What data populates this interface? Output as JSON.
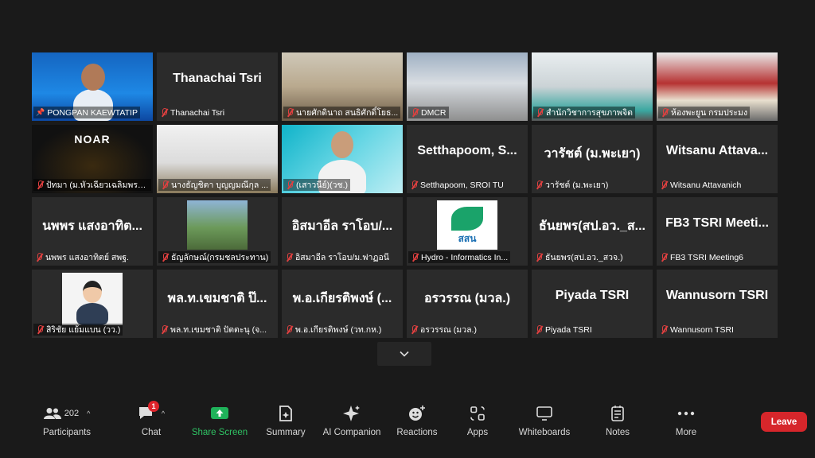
{
  "tiles": [
    {
      "name": "PONGPAN KAEWTATIP",
      "big": "",
      "kind": "video",
      "fill": "v-blue",
      "pinned": true,
      "muted": false,
      "active": true
    },
    {
      "name": "Thanachai Tsri",
      "big": "Thanachai Tsri",
      "kind": "name",
      "muted": true
    },
    {
      "name": "นายศักดินาถ สนธิศักดิ์โยธ...",
      "big": "",
      "kind": "video",
      "fill": "v-office",
      "muted": true
    },
    {
      "name": "DMCR",
      "big": "",
      "kind": "video",
      "fill": "v-room",
      "muted": true
    },
    {
      "name": "สำนักวิชาการสุขภาพจิต",
      "big": "",
      "kind": "video",
      "fill": "v-room2",
      "muted": true
    },
    {
      "name": "ห้องพะยูน กรมประมง",
      "big": "",
      "kind": "video",
      "fill": "v-hall",
      "muted": true
    },
    {
      "name": "ปัทมา (ม.หัวเฉียวเฉลิมพระ...",
      "big": "",
      "kind": "video",
      "fill": "v-dark",
      "muted": true,
      "logo": "NOAR"
    },
    {
      "name": "นางธัญชิตา บุญญมณีกุล ...",
      "big": "",
      "kind": "video",
      "fill": "v-desk",
      "muted": true
    },
    {
      "name": "(เสาวนีย์)(วช.)",
      "big": "",
      "kind": "video",
      "fill": "v-cyan",
      "muted": true
    },
    {
      "name": "Setthapoom, SROI TU",
      "big": "Setthapoom, S...",
      "kind": "name",
      "muted": true
    },
    {
      "name": "วารัชต์ (ม.พะเยา)",
      "big": "วารัชต์ (ม.พะเยา)",
      "kind": "name",
      "muted": true
    },
    {
      "name": "Witsanu Attavanich",
      "big": "Witsanu Attava...",
      "kind": "name",
      "muted": true
    },
    {
      "name": "นพพร แสงอาทิตย์ สพฐ.",
      "big": "นพพร แสงอาทิต...",
      "kind": "name",
      "muted": true
    },
    {
      "name": "ธัญลักษณ์(กรมชลประทาน)",
      "big": "",
      "kind": "image",
      "muted": true,
      "img": "photo"
    },
    {
      "name": "อิสมาอีล ราโอบ/ม.ฟาฏอนี",
      "big": "อิสมาอีล ราโอบ/...",
      "kind": "name",
      "muted": true
    },
    {
      "name": "Hydro - Informatics In...",
      "big": "",
      "kind": "image",
      "muted": true,
      "img": "logo",
      "logo_text": "สสน"
    },
    {
      "name": "ธันยพร(สป.อว._สวจ.)",
      "big": "ธันยพร(สป.อว._ส...",
      "kind": "name",
      "muted": true
    },
    {
      "name": "FB3 TSRI Meeting6",
      "big": "FB3 TSRI Meeti...",
      "kind": "name",
      "muted": true
    },
    {
      "name": "สิริชัย แย้มแบน (วว.)",
      "big": "",
      "kind": "image",
      "muted": true,
      "img": "avatar"
    },
    {
      "name": "พล.ท.เขมชาติ ปัตตะนุ (จ...",
      "big": "พล.ท.เขมชาติ ป๊...",
      "kind": "name",
      "muted": true
    },
    {
      "name": "พ.อ.เกียรติพงษ์ (วท.กห.)",
      "big": "พ.อ.เกียรติพงษ์ (...",
      "kind": "name",
      "muted": true
    },
    {
      "name": "อรวรรณ (มวล.)",
      "big": "อรวรรณ (มวล.)",
      "kind": "name",
      "muted": true
    },
    {
      "name": "Piyada TSRI",
      "big": "Piyada TSRI",
      "kind": "name",
      "muted": true
    },
    {
      "name": "Wannusorn TSRI",
      "big": "Wannusorn TSRI",
      "kind": "name",
      "muted": true
    }
  ],
  "toolbar": {
    "participants": {
      "label": "Participants",
      "count": "202"
    },
    "chat": {
      "label": "Chat",
      "badge": "1"
    },
    "share": {
      "label": "Share Screen"
    },
    "summary": {
      "label": "Summary"
    },
    "ai": {
      "label": "AI Companion"
    },
    "reactions": {
      "label": "Reactions"
    },
    "apps": {
      "label": "Apps"
    },
    "whiteboards": {
      "label": "Whiteboards"
    },
    "notes": {
      "label": "Notes"
    },
    "more": {
      "label": "More"
    },
    "leave": {
      "label": "Leave"
    }
  },
  "colors": {
    "background": "#1a1a1a",
    "tile": "#2b2b2b",
    "active_border": "#d6e04a",
    "share_green": "#2fc263",
    "leave_red": "#d6262b",
    "mute_red": "#e04040"
  }
}
